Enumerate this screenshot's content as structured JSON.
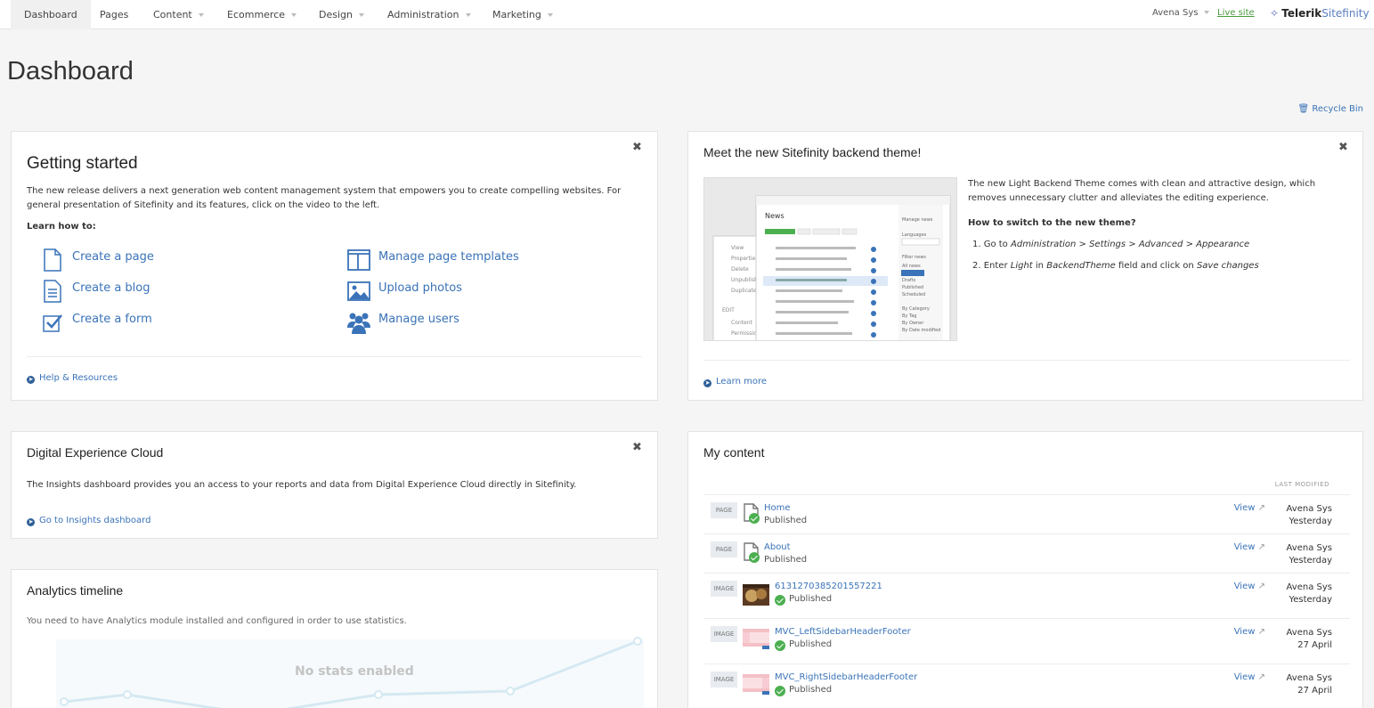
{
  "nav": {
    "items": [
      {
        "label": "Dashboard",
        "active": true,
        "caret": false
      },
      {
        "label": "Pages",
        "active": false,
        "caret": false
      },
      {
        "label": "Content",
        "active": false,
        "caret": true
      },
      {
        "label": "Ecommerce",
        "active": false,
        "caret": true
      },
      {
        "label": "Design",
        "active": false,
        "caret": true
      },
      {
        "label": "Administration",
        "active": false,
        "caret": true
      },
      {
        "label": "Marketing",
        "active": false,
        "caret": true
      }
    ],
    "user": "Avena Sys",
    "live_site": "Live site",
    "brand_a": "Telerik",
    "brand_b": "Sitefinity"
  },
  "page": {
    "title": "Dashboard",
    "recycle_bin": "Recycle Bin"
  },
  "getting_started": {
    "title": "Getting started",
    "description": "The new release delivers a next generation web content management system that empowers you to create compelling websites. For general presentation of Sitefinity and its features, click on the video to the left.",
    "learn_how": "Learn how to:",
    "links": [
      {
        "label": "Create a page",
        "icon": "page-icon"
      },
      {
        "label": "Create a blog",
        "icon": "blog-icon"
      },
      {
        "label": "Create a form",
        "icon": "form-icon"
      },
      {
        "label": "Manage page templates",
        "icon": "template-icon"
      },
      {
        "label": "Upload photos",
        "icon": "photo-icon"
      },
      {
        "label": "Manage users",
        "icon": "users-icon"
      }
    ],
    "help": "Help & Resources"
  },
  "theme": {
    "title": "Meet the new Sitefinity backend theme!",
    "intro": "The new Light Backend Theme comes with clean and attractive design, which removes unnecessary clutter and alleviates the editing experience.",
    "how_title": "How to switch to the new theme?",
    "step1_prefix": "1. Go to",
    "step1_path": "Administration > Settings > Advanced > Appearance",
    "step2_prefix": "2. Enter",
    "step2_value": "Light",
    "step2_in": "in",
    "step2_field": "BackendTheme",
    "step2_mid": "field and click on",
    "step2_action": "Save changes",
    "learn_more": "Learn more"
  },
  "dec": {
    "title": "Digital Experience Cloud",
    "description": "The Insights dashboard provides you an access to your reports and data from Digital Experience Cloud directly in Sitefinity.",
    "link": "Go to Insights dashboard"
  },
  "analytics": {
    "title": "Analytics timeline",
    "description": "You need to have Analytics module installed and configured in order to use statistics.",
    "empty": "No stats enabled"
  },
  "my_content": {
    "title": "My content",
    "col_header": "LAST MODIFIED",
    "view_label": "View",
    "rows": [
      {
        "type": "PAGE",
        "title": "Home",
        "status": "Published",
        "owner": "Avena Sys",
        "date": "Yesterday",
        "thumb": "page"
      },
      {
        "type": "PAGE",
        "title": "About",
        "status": "Published",
        "owner": "Avena Sys",
        "date": "Yesterday",
        "thumb": "page"
      },
      {
        "type": "IMAGE",
        "title": "6131270385201557221",
        "status": "Published",
        "owner": "Avena Sys",
        "date": "Yesterday",
        "thumb": "photo"
      },
      {
        "type": "IMAGE",
        "title": "MVC_LeftSidebarHeaderFooter",
        "status": "Published",
        "owner": "Avena Sys",
        "date": "27 April",
        "thumb": "layout"
      },
      {
        "type": "IMAGE",
        "title": "MVC_RightSidebarHeaderFooter",
        "status": "Published",
        "owner": "Avena Sys",
        "date": "27 April",
        "thumb": "layout"
      }
    ]
  }
}
